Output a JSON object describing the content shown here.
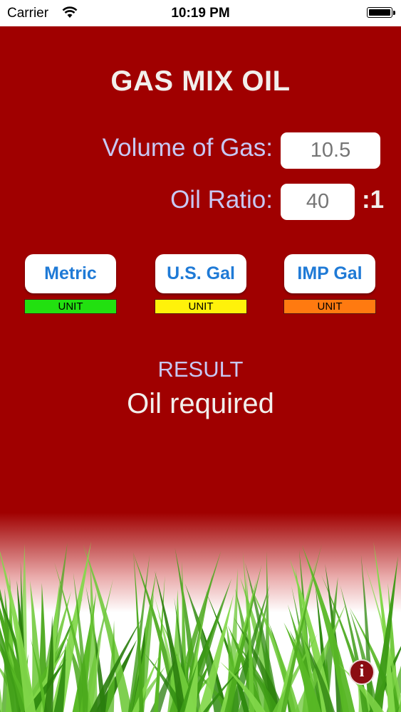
{
  "status_bar": {
    "carrier": "Carrier",
    "time": "10:19 PM"
  },
  "app": {
    "title": "GAS MIX OIL"
  },
  "form": {
    "volume_label": "Volume of Gas:",
    "volume_placeholder": "10.5",
    "ratio_label": "Oil Ratio:",
    "ratio_placeholder": "40",
    "ratio_suffix": ":1"
  },
  "units": [
    {
      "label": "Metric",
      "bar_text": "UNIT",
      "bar_color": "#22e010"
    },
    {
      "label": "U.S. Gal",
      "bar_text": "UNIT",
      "bar_color": "#fff20a"
    },
    {
      "label": "IMP Gal",
      "bar_text": "UNIT",
      "bar_color": "#ff7a10"
    }
  ],
  "result": {
    "label": "RESULT",
    "value": "Oil required"
  },
  "info_button": {
    "glyph": "i",
    "icon": "info-icon"
  },
  "colors": {
    "background": "#a00000",
    "button_text": "#1f7ad6",
    "label_text": "#c8c8f4"
  }
}
